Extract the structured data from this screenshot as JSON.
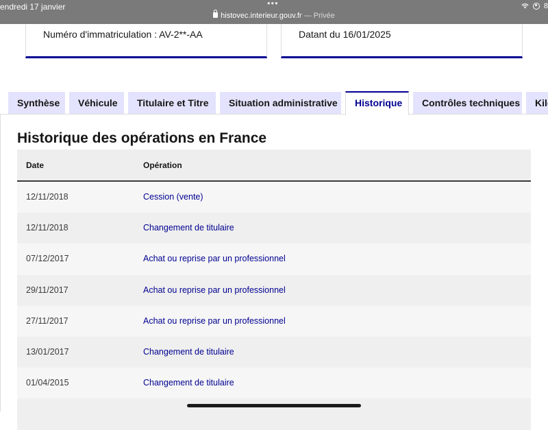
{
  "statusbar": {
    "time": "endredi 17 janvier",
    "dots": "•••",
    "url": "histovec.interieur.gouv.fr",
    "private": " — Privée",
    "battery": "8"
  },
  "cards": {
    "left": "Numéro d'immatriculation : AV-2**-AA",
    "right": "Datant du 16/01/2025"
  },
  "tabs": [
    {
      "label": "Synthèse"
    },
    {
      "label": "Véhicule"
    },
    {
      "label": "Titulaire et Titre"
    },
    {
      "label": "Situation administrative"
    },
    {
      "label": "Historique"
    },
    {
      "label": "Contrôles techniques"
    },
    {
      "label": "Kilo"
    }
  ],
  "section": {
    "title": "Historique des opérations en France"
  },
  "table": {
    "headers": {
      "date": "Date",
      "operation": "Opération"
    },
    "rows": [
      {
        "date": "12/11/2018",
        "operation": "Cession (vente)"
      },
      {
        "date": "12/11/2018",
        "operation": "Changement de titulaire"
      },
      {
        "date": "07/12/2017",
        "operation": "Achat ou reprise par un professionnel"
      },
      {
        "date": "29/11/2017",
        "operation": "Achat ou reprise par un professionnel"
      },
      {
        "date": "27/11/2017",
        "operation": "Achat ou reprise par un professionnel"
      },
      {
        "date": "13/01/2017",
        "operation": "Changement de titulaire"
      },
      {
        "date": "01/04/2015",
        "operation": "Changement de titulaire"
      },
      {
        "date": "",
        "operation": ""
      }
    ]
  },
  "colors": {
    "accent": "#000091",
    "tab_bg": "#e3e3fd",
    "statusbar": "#7a7a7a"
  }
}
